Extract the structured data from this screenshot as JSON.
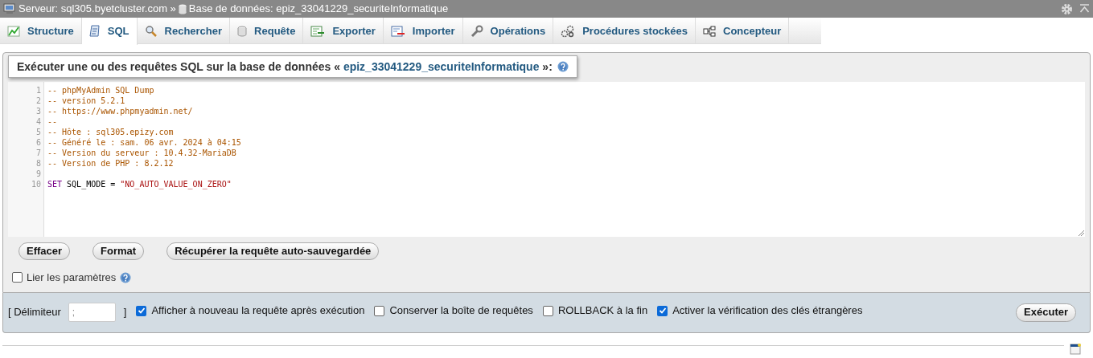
{
  "breadcrumb": {
    "server": "Serveur: sql305.byetcluster.com »",
    "database": "Base de données: epiz_33041229_securiteInformatique"
  },
  "tabs": [
    {
      "label": "Structure",
      "selected": false
    },
    {
      "label": "SQL",
      "selected": true
    },
    {
      "label": "Rechercher",
      "selected": false
    },
    {
      "label": "Requête",
      "selected": false
    },
    {
      "label": "Exporter",
      "selected": false
    },
    {
      "label": "Importer",
      "selected": false
    },
    {
      "label": "Opérations",
      "selected": false
    },
    {
      "label": "Procédures stockées",
      "selected": false
    },
    {
      "label": "Concepteur",
      "selected": false
    }
  ],
  "query_box": {
    "title": "Exécuter une ou des requêtes SQL sur la base de données « ",
    "database": "epiz_33041229_securiteInformatique",
    "title_end": " »:"
  },
  "editor": {
    "lines": [
      {
        "number": "1",
        "segments": [
          {
            "kind": "comment",
            "text": "-- phpMyAdmin SQL Dump"
          }
        ]
      },
      {
        "number": "2",
        "segments": [
          {
            "kind": "comment",
            "text": "-- version 5.2.1"
          }
        ]
      },
      {
        "number": "3",
        "segments": [
          {
            "kind": "comment",
            "text": "-- https://www.phpmyadmin.net/"
          }
        ]
      },
      {
        "number": "4",
        "segments": [
          {
            "kind": "comment",
            "text": "--"
          }
        ]
      },
      {
        "number": "5",
        "segments": [
          {
            "kind": "comment",
            "text": "-- Hôte : sql305.epizy.com"
          }
        ]
      },
      {
        "number": "6",
        "segments": [
          {
            "kind": "comment",
            "text": "-- Généré le : sam. 06 avr. 2024 à 04:15"
          }
        ]
      },
      {
        "number": "7",
        "segments": [
          {
            "kind": "comment",
            "text": "-- Version du serveur : 10.4.32-MariaDB"
          }
        ]
      },
      {
        "number": "8",
        "segments": [
          {
            "kind": "comment",
            "text": "-- Version de PHP : 8.2.12"
          }
        ]
      },
      {
        "number": "9"
      },
      {
        "number": "10",
        "segments": [
          {
            "kind": "keyword",
            "text": "SET"
          },
          {
            "kind": "plain",
            "text": " SQL_MODE = "
          },
          {
            "kind": "string",
            "text": "\"NO_AUTO_VALUE_ON_ZERO\""
          }
        ]
      }
    ]
  },
  "buttons": [
    "Effacer",
    "Format",
    "Récupérer la requête auto-sauvegardée"
  ],
  "bind_parameters": {
    "label": "Lier les paramètres",
    "checked": false
  },
  "options": {
    "delimiter_open": "[ Délimiteur",
    "delimiter_value": ";",
    "delimiter_close": "]",
    "checkboxes": [
      {
        "label": "Afficher à nouveau la requête après exécution",
        "checked": true
      },
      {
        "label": "Conserver la boîte de requêtes",
        "checked": false
      },
      {
        "label": "ROLLBACK à la fin",
        "checked": false
      },
      {
        "label": "Activer la vérification des clés étrangères",
        "checked": true
      }
    ],
    "submit": "Exécuter"
  }
}
